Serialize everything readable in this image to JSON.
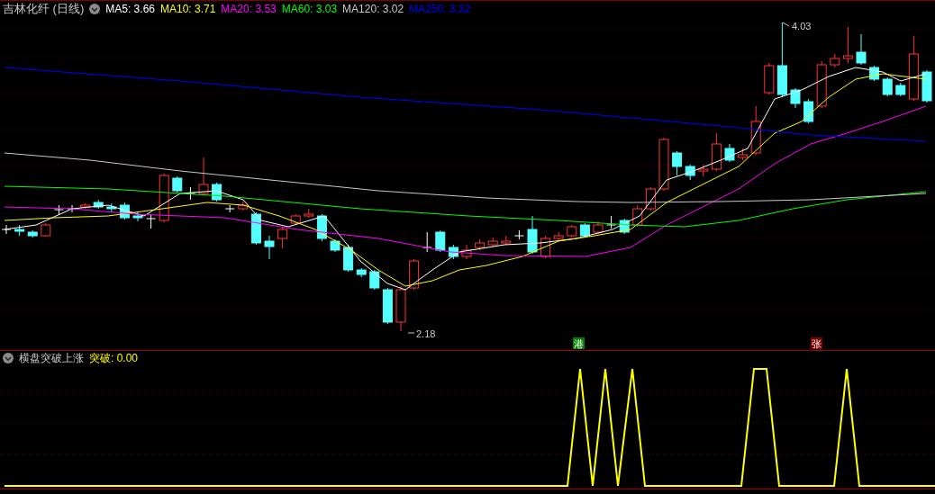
{
  "chart": {
    "title": "吉林化纤 (日线)",
    "moving_averages": [
      {
        "label": "MA5: 3.66",
        "color": "#ffffff"
      },
      {
        "label": "MA10: 3.71",
        "color": "#ffff00"
      },
      {
        "label": "MA20: 3.53",
        "color": "#ff00ff"
      },
      {
        "label": "MA60: 3.03",
        "color": "#00ff00"
      },
      {
        "label": "MA120: 3.02",
        "color": "#c8c8c8"
      },
      {
        "label": "MA250: 3.32",
        "color": "#0000ff"
      }
    ],
    "high_label": "4.03",
    "low_label": "2.18",
    "signals": [
      {
        "text": "港",
        "color": "#008000"
      },
      {
        "text": "张",
        "color": "#800000"
      }
    ]
  },
  "indicator": {
    "title": "横盘突破上涨",
    "value_label": "突破: 0.00"
  }
}
